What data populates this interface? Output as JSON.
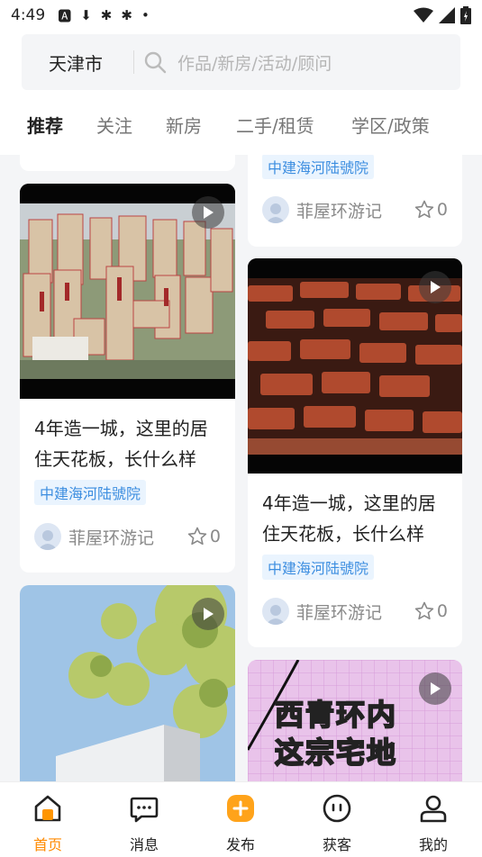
{
  "status_bar": {
    "time": "4:49"
  },
  "header": {
    "city": "天津市",
    "search_placeholder": "作品/新房/活动/顾问"
  },
  "tabs": [
    {
      "label": "推荐",
      "active": true
    },
    {
      "label": "关注",
      "active": false
    },
    {
      "label": "新房",
      "active": false
    },
    {
      "label": "二手/租赁",
      "active": false
    },
    {
      "label": "学区/政策",
      "active": false
    }
  ],
  "feed": {
    "cards": [
      {
        "tag": "中建海河陆號院",
        "author": "菲屋环游记",
        "likes": "0"
      },
      {
        "title": "4年造一城，这里的居住天花板，长什么样",
        "tag": "中建海河陆號院",
        "author": "菲屋环游记",
        "likes": "0",
        "media": "model-city"
      },
      {
        "title": "4年造一城，这里的居住天花板，长什么样",
        "tag": "中建海河陆號院",
        "author": "菲屋环游记",
        "likes": "0",
        "media": "brick-wall"
      },
      {
        "media": "trees-building"
      },
      {
        "media": "pink-grid",
        "overlay_text_line1": "西青环内",
        "overlay_text_line2": "这宗宅地"
      }
    ]
  },
  "bottom_nav": [
    {
      "label": "首页",
      "icon": "home-icon",
      "active": true
    },
    {
      "label": "消息",
      "icon": "message-icon",
      "active": false
    },
    {
      "label": "发布",
      "icon": "publish-icon",
      "active": false
    },
    {
      "label": "获客",
      "icon": "customer-icon",
      "active": false
    },
    {
      "label": "我的",
      "icon": "profile-icon",
      "active": false
    }
  ],
  "colors": {
    "accent": "#ff9500",
    "tag_bg": "#eaf4fe",
    "tag_text": "#3d8ee0"
  }
}
